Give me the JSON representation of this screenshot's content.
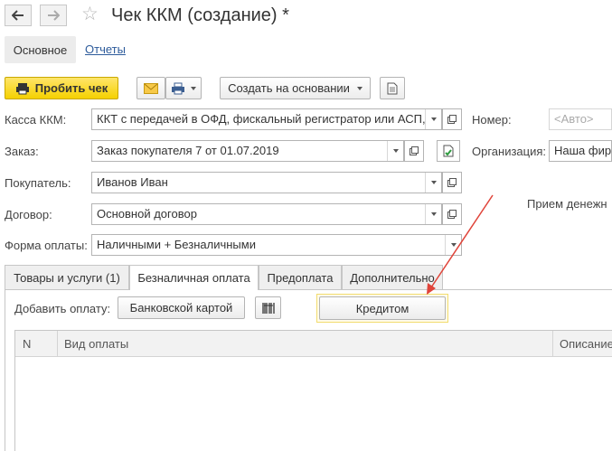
{
  "window": {
    "title": "Чек ККМ (создание) *",
    "back_icon": "arrow-left-icon",
    "forward_icon": "arrow-right-icon",
    "favorite_icon": "star-icon"
  },
  "section_tabs": {
    "main": "Основное",
    "reports": "Отчеты"
  },
  "toolbar": {
    "punch_check": "Пробить чек",
    "create_based_on": "Создать на основании"
  },
  "form": {
    "kassa_label": "Касса ККМ:",
    "kassa_value": "ККТ с передачей в ОФД, фискальный регистратор или АСП,",
    "number_label": "Номер:",
    "number_placeholder": "<Авто>",
    "order_label": "Заказ:",
    "order_value": "Заказ покупателя 7 от 01.07.2019",
    "organization_label": "Организация:",
    "organization_value": "Наша фирм",
    "buyer_label": "Покупатель:",
    "buyer_value": "Иванов Иван",
    "contract_label": "Договор:",
    "contract_value": "Основной договор",
    "payment_form_label": "Форма оплаты:",
    "payment_form_value": "Наличными + Безналичными",
    "money_receipt_text": "Прием денежн"
  },
  "inner_tabs": {
    "goods": "Товары и услуги (1)",
    "cashless": "Безналичная оплата",
    "prepayment": "Предоплата",
    "additional": "Дополнительно"
  },
  "payment": {
    "add_label": "Добавить оплату:",
    "bank_card": "Банковской картой",
    "credit": "Кредитом"
  },
  "table": {
    "columns": [
      "N",
      "Вид оплаты",
      "Описание"
    ]
  },
  "colors": {
    "accent_yellow": "#f5d100",
    "link_blue": "#2d5b9b",
    "annotation_arrow": "#e0443a"
  }
}
